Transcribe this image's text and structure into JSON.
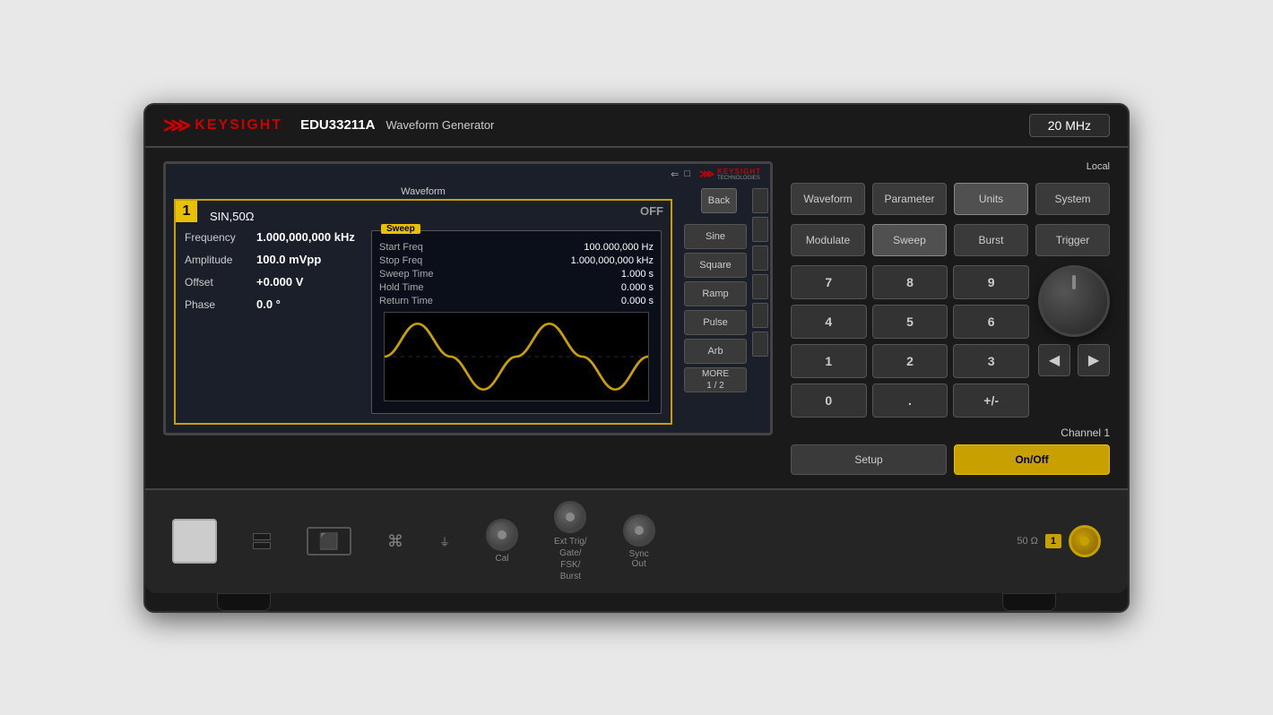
{
  "instrument": {
    "brand": "KEYSIGHT",
    "model": "EDU33211A",
    "subtitle": "Waveform Generator",
    "frequency": "20 MHz"
  },
  "screen": {
    "channel": "1",
    "waveform_type": "SIN,50Ω",
    "status": "OFF",
    "icons": "⇐ □",
    "params": {
      "frequency_label": "Frequency",
      "frequency_value": "1.000,000,000 kHz",
      "amplitude_label": "Amplitude",
      "amplitude_value": "100.0 mVpp",
      "offset_label": "Offset",
      "offset_value": "+0.000 V",
      "phase_label": "Phase",
      "phase_value": "0.0 °"
    },
    "sweep": {
      "label": "Sweep",
      "start_freq_label": "Start Freq",
      "start_freq_value": "100.000,000 Hz",
      "stop_freq_label": "Stop Freq",
      "stop_freq_value": "1.000,000,000 kHz",
      "sweep_time_label": "Sweep Time",
      "sweep_time_value": "1.000 s",
      "hold_time_label": "Hold Time",
      "hold_time_value": "0.000 s",
      "return_time_label": "Return Time",
      "return_time_value": "0.000 s"
    }
  },
  "waveform_buttons": {
    "section_label": "Waveform",
    "buttons": [
      "Sine",
      "Square",
      "Ramp",
      "Pulse",
      "Arb"
    ],
    "more_label": "MORE\n1 / 2"
  },
  "controls": {
    "local_label": "Local",
    "top_row": [
      "Waveform",
      "Parameter",
      "Units",
      "System"
    ],
    "second_row": [
      "Modulate",
      "Sweep",
      "Burst",
      "Trigger"
    ],
    "numpad": [
      "7",
      "8",
      "9",
      "4",
      "5",
      "6",
      "1",
      "2",
      "3",
      "0",
      ".",
      "+/-"
    ],
    "channel_label": "Channel 1",
    "setup_label": "Setup",
    "onoff_label": "On/Off",
    "back_label": "Back",
    "arrow_left": "◀",
    "arrow_right": "▶"
  },
  "bottom_panel": {
    "cal_label": "Cal",
    "ext_trig_label": "Ext Trig/\nGate/\nFSK/\nBurst",
    "sync_out_label": "Sync\nOut",
    "ohm_label": "50 Ω",
    "ch1_label": "1",
    "ground_label": "⏚"
  }
}
